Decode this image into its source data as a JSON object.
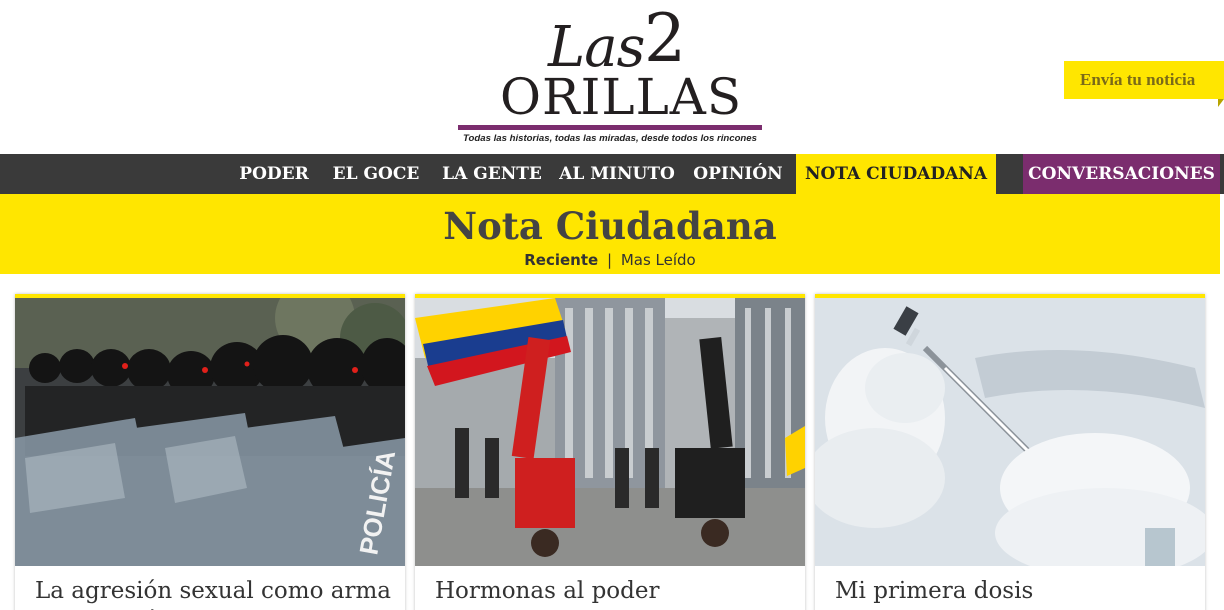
{
  "header": {
    "logo": {
      "word1": "Las",
      "number": "2",
      "word2": "ORILLAS"
    },
    "tagline": "Todas las historias, todas las miradas, desde todos los rincones",
    "cta_label": "Envía tu noticia"
  },
  "nav": {
    "items": [
      {
        "label": "PODER"
      },
      {
        "label": "EL GOCE"
      },
      {
        "label": "LA GENTE"
      },
      {
        "label": "AL MINUTO"
      },
      {
        "label": "OPINIÓN"
      },
      {
        "label": "NOTA CIUDADANA"
      },
      {
        "label": "CONVERSACIONES"
      }
    ],
    "active": "NOTA CIUDADANA"
  },
  "section": {
    "title": "Nota Ciudadana",
    "tabs": [
      "Reciente",
      "Mas Leído"
    ],
    "separator": "|",
    "active_tab": "Reciente"
  },
  "cards": [
    {
      "title": "La agresión sexual como arma de opresión",
      "image": "riot-police-photo"
    },
    {
      "title": "Hormonas al poder",
      "image": "street-protest-photo"
    },
    {
      "title": "Mi primera dosis",
      "image": "vaccine-syringe-photo"
    }
  ],
  "colors": {
    "accent_yellow": "#ffe600",
    "brand_purple": "#7b2d6e",
    "nav_dark": "#3a3a3a"
  }
}
